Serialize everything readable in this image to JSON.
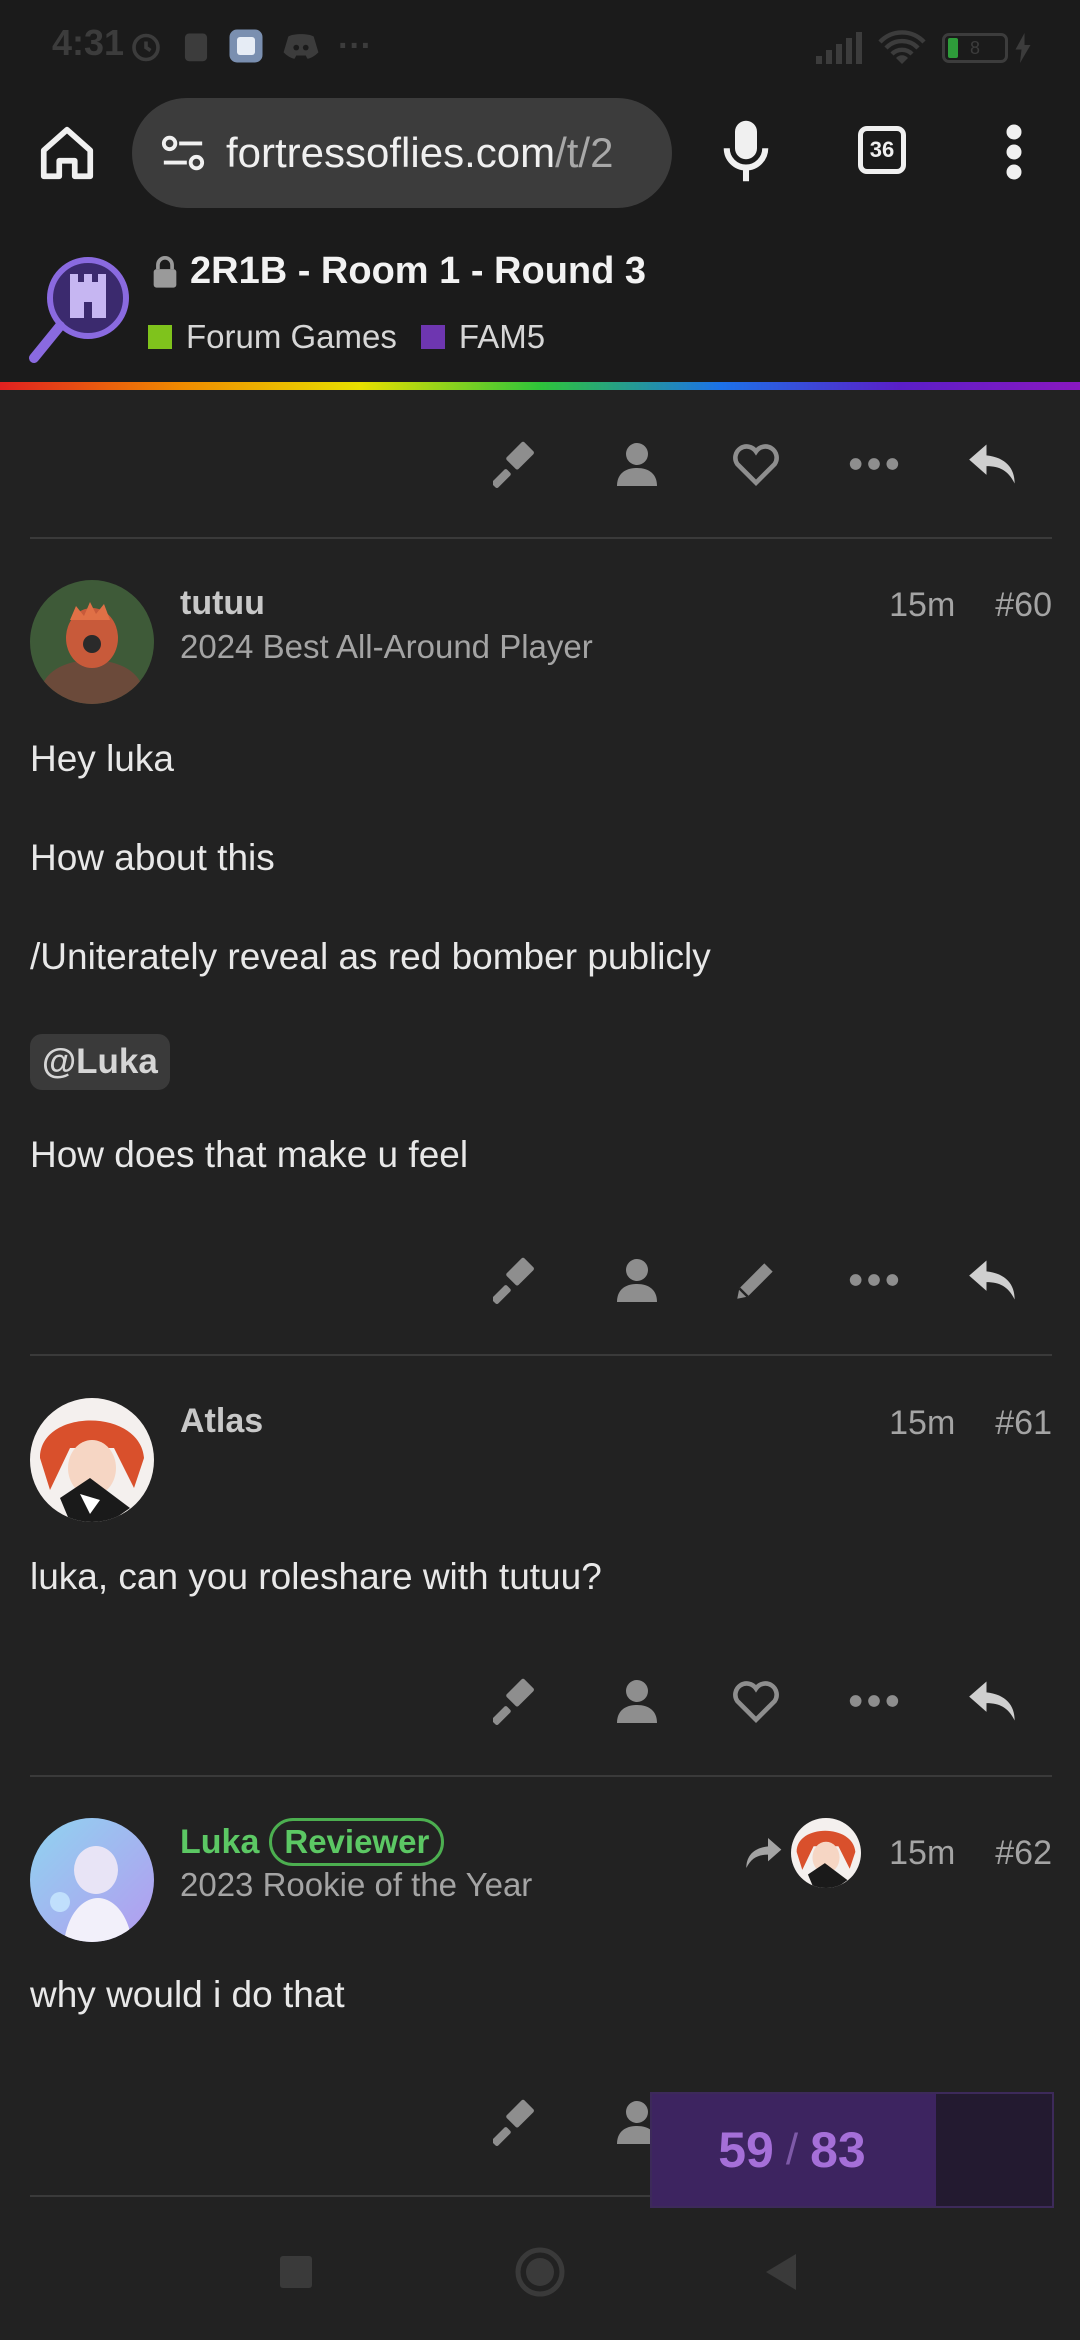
{
  "status_bar": {
    "time": "4:31",
    "battery_level": "8"
  },
  "browser": {
    "url_host": "fortressoflies.com",
    "url_path": "/t/2",
    "tab_count": "36"
  },
  "topic": {
    "title": "2R1B - Room 1 - Round 3",
    "categories": [
      {
        "label": "Forum Games",
        "color": "#7fc31c"
      },
      {
        "label": "FAM5",
        "color": "#6e36b0"
      }
    ]
  },
  "posts": [
    {
      "username": "tutuu",
      "user_title": "2024 Best All-Around Player",
      "time": "15m",
      "post_number": "#60",
      "paragraphs": [
        "Hey luka",
        "How about this",
        "/Uniterately reveal as red bomber publicly"
      ],
      "mention": "@Luka",
      "closing": "How does that make u feel"
    },
    {
      "username": "Atlas",
      "time": "15m",
      "post_number": "#61",
      "paragraphs": [
        "luka, can you roleshare with tutuu?"
      ]
    },
    {
      "username": "Luka",
      "badge": "Reviewer",
      "user_title": "2023 Rookie of the Year",
      "time": "15m",
      "post_number": "#62",
      "paragraphs": [
        "why would i do that"
      ]
    }
  ],
  "progress": {
    "current": "59",
    "separator": "/",
    "total": "83",
    "fraction": 0.71
  },
  "icons": {
    "action_row": [
      "gavel-icon",
      "user-icon",
      "heart-icon",
      "more-icon",
      "reply-icon"
    ],
    "own_post_row": [
      "gavel-icon",
      "user-icon",
      "pencil-icon",
      "more-icon",
      "reply-icon"
    ]
  }
}
